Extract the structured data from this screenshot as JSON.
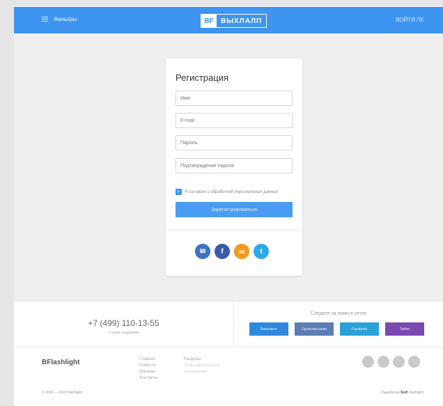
{
  "header": {
    "menu_label": "Ф̶и̶л̶ь̶т̶р̶ы̶",
    "logo_mark": "BF",
    "logo_text": "ВЫХЛАЛП",
    "login_label": "ВОЙТИ  ЛК"
  },
  "registration": {
    "title": "Регистрация",
    "fields": [
      {
        "placeholder": "Имя"
      },
      {
        "placeholder": "E-mail"
      },
      {
        "placeholder": "Пароль"
      },
      {
        "placeholder": "Подтверждение пароля"
      }
    ],
    "agree_text": "Я согласен с обработкой персональных данных",
    "submit_label": "Зарегистрироваться",
    "social_logins": [
      {
        "icon": "mail-ru-icon",
        "glyph": "✉",
        "color": "#3a73c4"
      },
      {
        "icon": "facebook-icon",
        "glyph": "f",
        "color": "#3b5ba6"
      },
      {
        "icon": "odnoklassniki-icon",
        "glyph": "ок",
        "color": "#f39a1e"
      },
      {
        "icon": "twitter-icon",
        "glyph": "t",
        "color": "#2ea8e6"
      }
    ]
  },
  "contact": {
    "phone": "+7 (499) 110-13-55",
    "phone_caption": "Служба поддержки",
    "follow_label": "Следите за нами в сетях",
    "social_buttons": [
      {
        "label": "Вконтакте",
        "color": "#2f88df"
      },
      {
        "label": "Одноклассники",
        "color": "#5b7db3"
      },
      {
        "label": "Facebook",
        "color": "#2aa2d9"
      },
      {
        "label": "Twitter",
        "color": "#7b49b0"
      }
    ]
  },
  "footer": {
    "logo": "BFlashlight",
    "col1": [
      "Главная",
      "Новости",
      "Магазин",
      "Контакты"
    ],
    "col2_title": "Разделы",
    "col2_muted": [
      "Пользовательское",
      "соглашение"
    ],
    "copyright": "© 2016 — 2018 Flashlight",
    "made_by_prefix": "Разработка",
    "made_by_brand": "БеИ",
    "made_by_suffix": "Flashlight"
  }
}
